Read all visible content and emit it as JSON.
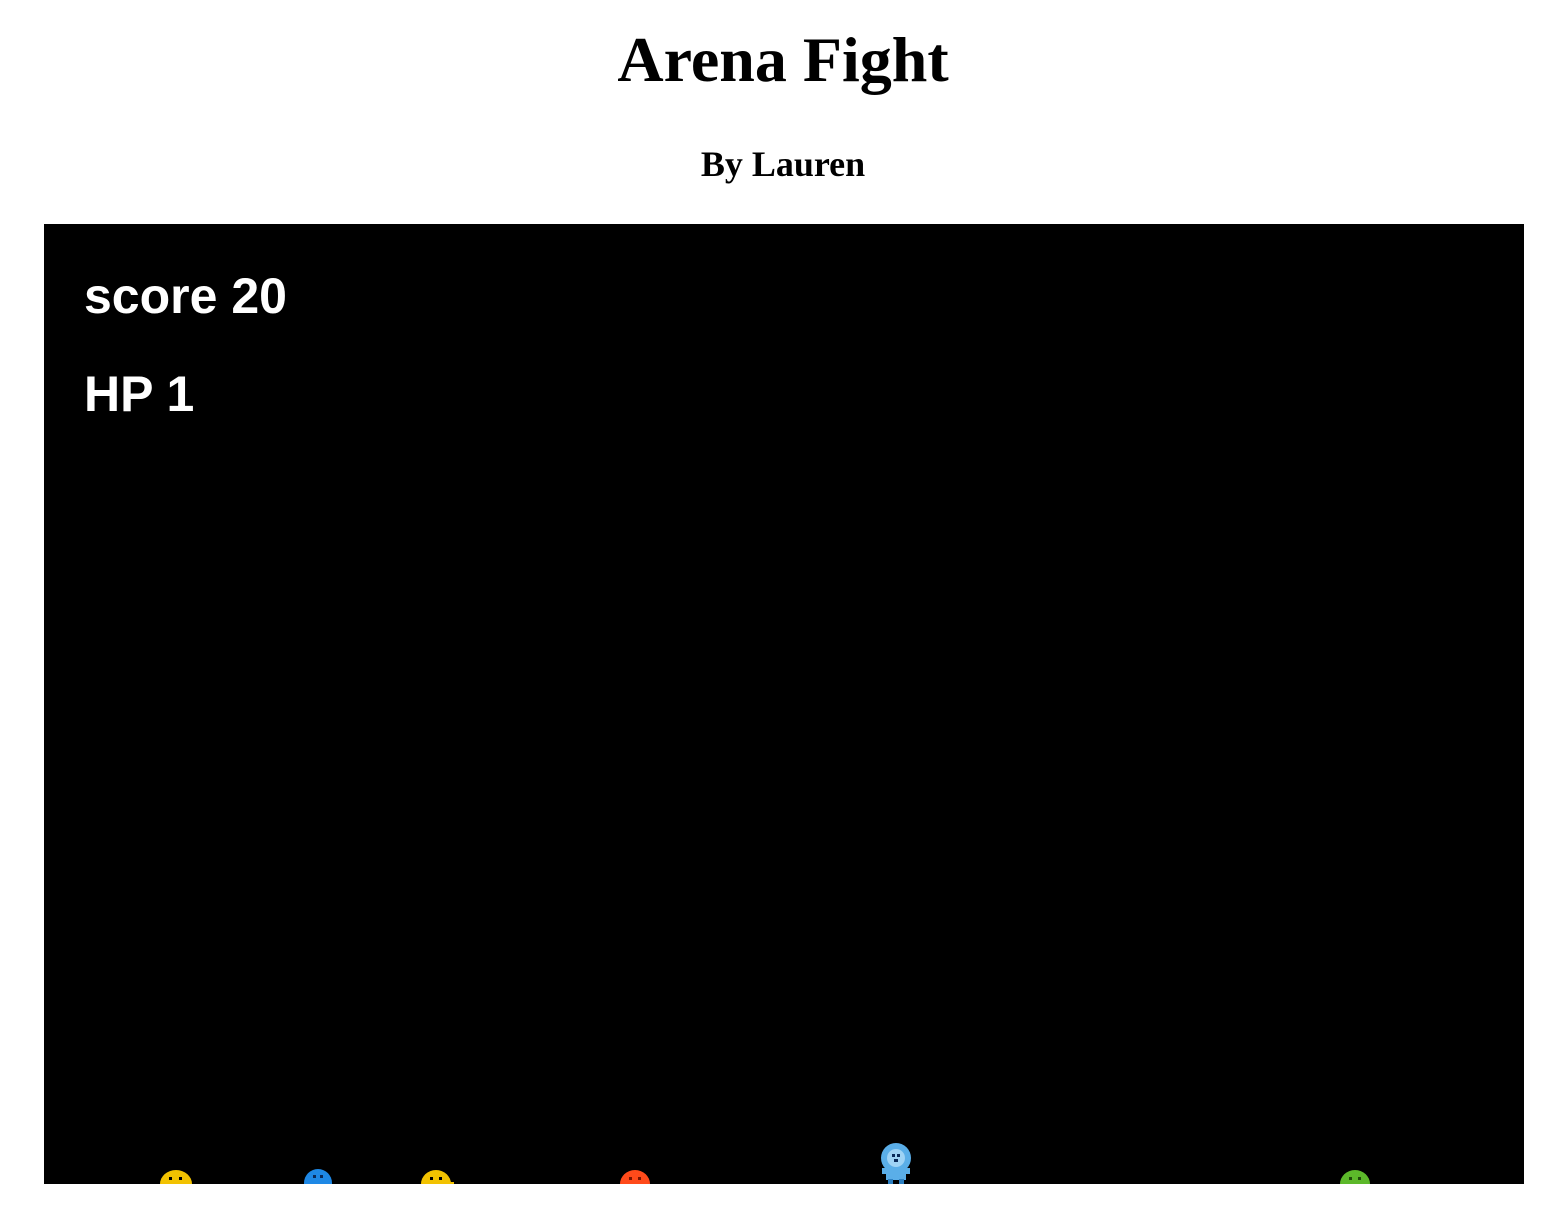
{
  "page": {
    "title": "Arena Fight",
    "subtitle": "By Lauren"
  },
  "hud": {
    "score_label": "score",
    "score_value": "20",
    "hp_label": "HP",
    "hp_value": "1"
  },
  "sprites": {
    "player": {
      "kind": "player",
      "color": "#5aaee8"
    },
    "enemies": [
      {
        "kind": "enemy",
        "color": "#f2c200"
      },
      {
        "kind": "enemy",
        "color": "#1e88e5"
      },
      {
        "kind": "enemy",
        "color": "#f2c200"
      },
      {
        "kind": "enemy",
        "color": "#ff4a1a"
      },
      {
        "kind": "enemy",
        "color": "#5cb82a"
      }
    ]
  }
}
